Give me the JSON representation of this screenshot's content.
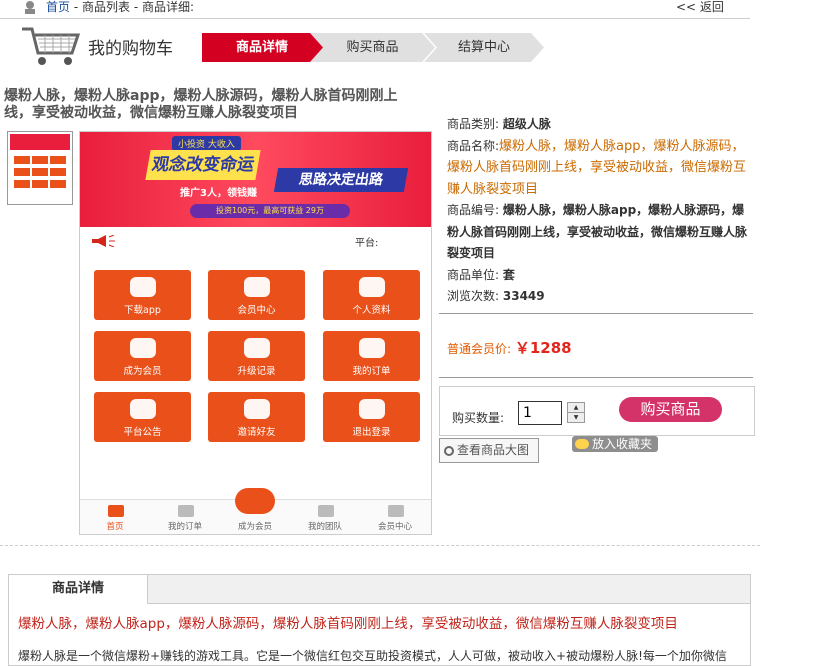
{
  "breadcrumb": {
    "home": "首页",
    "sep1": " - ",
    "list": "商品列表",
    "sep2": " - ",
    "detail": "商品详细:",
    "back": "<< 返回"
  },
  "header": {
    "title": "我的购物车"
  },
  "steps": [
    "商品详情",
    "购买商品",
    "结算中心"
  ],
  "product": {
    "title": "爆粉人脉，爆粉人脉app，爆粉人脉源码，爆粉人脉首码刚刚上线，享受被动收益，微信爆粉互赚人脉裂变项目",
    "category_label": "商品类别:",
    "category": "超级人脉",
    "name_label": "商品名称:",
    "name": "爆粉人脉，爆粉人脉app，爆粉人脉源码，爆粉人脉首码刚刚上线，享受被动收益，微信爆粉互赚人脉裂变项目",
    "code_label": "商品编号:",
    "code": "爆粉人脉，爆粉人脉app，爆粉人脉源码，爆粉人脉首码刚刚上线，享受被动收益，微信爆粉互赚人脉裂变项目",
    "unit_label": "商品单位:",
    "unit": "套",
    "views_label": "浏览次数:",
    "views": "33449",
    "price_label": "普通会员价:",
    "price": "￥1288"
  },
  "purchase": {
    "qty_label": "购买数量:",
    "qty": "1",
    "buy_label": "购买商品",
    "fav_label": "放入收藏夹",
    "zoom_label": "查看商品大图"
  },
  "detail": {
    "tab": "商品详情",
    "heading": "爆粉人脉，爆粉人脉app，爆粉人脉源码，爆粉人脉首码刚刚上线，享受被动收益，微信爆粉互赚人脉裂变项目",
    "body": "爆粉人脉是一个微信爆粉+赚钱的游戏工具。它是一个微信红包交互助投资模式，人人可做，被动收入+被动爆粉人脉!每一个加你微信"
  },
  "phone": {
    "banner_top": "小投资 大收入",
    "banner_main1": "观念改变命运",
    "banner_main2": "思路决定出路",
    "banner_mid": "推广3人，领钱赚",
    "banner_bottom": "投资100元，最高可获益 29万",
    "platform": "平台:",
    "menu": [
      "下载app",
      "会员中心",
      "个人资料",
      "成为会员",
      "升级记录",
      "我的订单",
      "平台公告",
      "邀请好友",
      "退出登录"
    ],
    "nav": [
      "首页",
      "我的订单",
      "成为会员",
      "我的团队",
      "会员中心"
    ]
  },
  "colors": {
    "accent": "#d40022",
    "buy": "#d4336a",
    "price": "#e2261b",
    "menu": "#e9501a"
  }
}
